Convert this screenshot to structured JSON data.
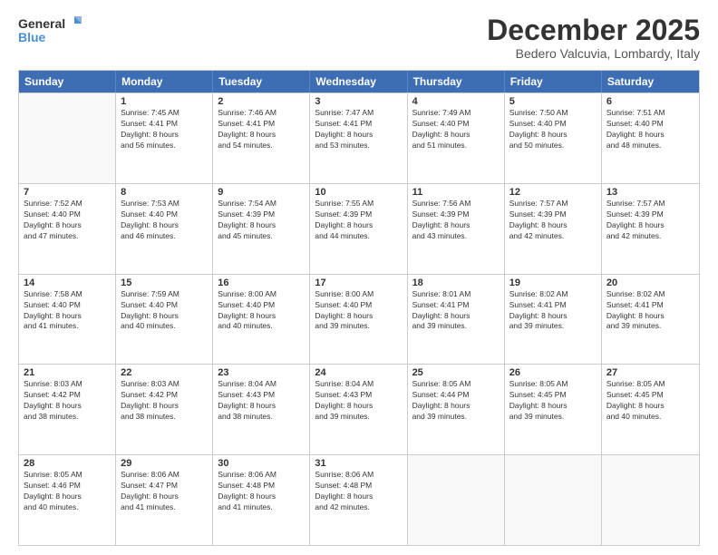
{
  "logo": {
    "line1": "General",
    "line2": "Blue"
  },
  "title": "December 2025",
  "subtitle": "Bedero Valcuvia, Lombardy, Italy",
  "header_days": [
    "Sunday",
    "Monday",
    "Tuesday",
    "Wednesday",
    "Thursday",
    "Friday",
    "Saturday"
  ],
  "weeks": [
    [
      {
        "day": "",
        "sunrise": "",
        "sunset": "",
        "daylight": ""
      },
      {
        "day": "1",
        "sunrise": "Sunrise: 7:45 AM",
        "sunset": "Sunset: 4:41 PM",
        "daylight": "Daylight: 8 hours",
        "daylight2": "and 56 minutes."
      },
      {
        "day": "2",
        "sunrise": "Sunrise: 7:46 AM",
        "sunset": "Sunset: 4:41 PM",
        "daylight": "Daylight: 8 hours",
        "daylight2": "and 54 minutes."
      },
      {
        "day": "3",
        "sunrise": "Sunrise: 7:47 AM",
        "sunset": "Sunset: 4:41 PM",
        "daylight": "Daylight: 8 hours",
        "daylight2": "and 53 minutes."
      },
      {
        "day": "4",
        "sunrise": "Sunrise: 7:49 AM",
        "sunset": "Sunset: 4:40 PM",
        "daylight": "Daylight: 8 hours",
        "daylight2": "and 51 minutes."
      },
      {
        "day": "5",
        "sunrise": "Sunrise: 7:50 AM",
        "sunset": "Sunset: 4:40 PM",
        "daylight": "Daylight: 8 hours",
        "daylight2": "and 50 minutes."
      },
      {
        "day": "6",
        "sunrise": "Sunrise: 7:51 AM",
        "sunset": "Sunset: 4:40 PM",
        "daylight": "Daylight: 8 hours",
        "daylight2": "and 48 minutes."
      }
    ],
    [
      {
        "day": "7",
        "sunrise": "Sunrise: 7:52 AM",
        "sunset": "Sunset: 4:40 PM",
        "daylight": "Daylight: 8 hours",
        "daylight2": "and 47 minutes."
      },
      {
        "day": "8",
        "sunrise": "Sunrise: 7:53 AM",
        "sunset": "Sunset: 4:40 PM",
        "daylight": "Daylight: 8 hours",
        "daylight2": "and 46 minutes."
      },
      {
        "day": "9",
        "sunrise": "Sunrise: 7:54 AM",
        "sunset": "Sunset: 4:39 PM",
        "daylight": "Daylight: 8 hours",
        "daylight2": "and 45 minutes."
      },
      {
        "day": "10",
        "sunrise": "Sunrise: 7:55 AM",
        "sunset": "Sunset: 4:39 PM",
        "daylight": "Daylight: 8 hours",
        "daylight2": "and 44 minutes."
      },
      {
        "day": "11",
        "sunrise": "Sunrise: 7:56 AM",
        "sunset": "Sunset: 4:39 PM",
        "daylight": "Daylight: 8 hours",
        "daylight2": "and 43 minutes."
      },
      {
        "day": "12",
        "sunrise": "Sunrise: 7:57 AM",
        "sunset": "Sunset: 4:39 PM",
        "daylight": "Daylight: 8 hours",
        "daylight2": "and 42 minutes."
      },
      {
        "day": "13",
        "sunrise": "Sunrise: 7:57 AM",
        "sunset": "Sunset: 4:39 PM",
        "daylight": "Daylight: 8 hours",
        "daylight2": "and 42 minutes."
      }
    ],
    [
      {
        "day": "14",
        "sunrise": "Sunrise: 7:58 AM",
        "sunset": "Sunset: 4:40 PM",
        "daylight": "Daylight: 8 hours",
        "daylight2": "and 41 minutes."
      },
      {
        "day": "15",
        "sunrise": "Sunrise: 7:59 AM",
        "sunset": "Sunset: 4:40 PM",
        "daylight": "Daylight: 8 hours",
        "daylight2": "and 40 minutes."
      },
      {
        "day": "16",
        "sunrise": "Sunrise: 8:00 AM",
        "sunset": "Sunset: 4:40 PM",
        "daylight": "Daylight: 8 hours",
        "daylight2": "and 40 minutes."
      },
      {
        "day": "17",
        "sunrise": "Sunrise: 8:00 AM",
        "sunset": "Sunset: 4:40 PM",
        "daylight": "Daylight: 8 hours",
        "daylight2": "and 39 minutes."
      },
      {
        "day": "18",
        "sunrise": "Sunrise: 8:01 AM",
        "sunset": "Sunset: 4:41 PM",
        "daylight": "Daylight: 8 hours",
        "daylight2": "and 39 minutes."
      },
      {
        "day": "19",
        "sunrise": "Sunrise: 8:02 AM",
        "sunset": "Sunset: 4:41 PM",
        "daylight": "Daylight: 8 hours",
        "daylight2": "and 39 minutes."
      },
      {
        "day": "20",
        "sunrise": "Sunrise: 8:02 AM",
        "sunset": "Sunset: 4:41 PM",
        "daylight": "Daylight: 8 hours",
        "daylight2": "and 39 minutes."
      }
    ],
    [
      {
        "day": "21",
        "sunrise": "Sunrise: 8:03 AM",
        "sunset": "Sunset: 4:42 PM",
        "daylight": "Daylight: 8 hours",
        "daylight2": "and 38 minutes."
      },
      {
        "day": "22",
        "sunrise": "Sunrise: 8:03 AM",
        "sunset": "Sunset: 4:42 PM",
        "daylight": "Daylight: 8 hours",
        "daylight2": "and 38 minutes."
      },
      {
        "day": "23",
        "sunrise": "Sunrise: 8:04 AM",
        "sunset": "Sunset: 4:43 PM",
        "daylight": "Daylight: 8 hours",
        "daylight2": "and 38 minutes."
      },
      {
        "day": "24",
        "sunrise": "Sunrise: 8:04 AM",
        "sunset": "Sunset: 4:43 PM",
        "daylight": "Daylight: 8 hours",
        "daylight2": "and 39 minutes."
      },
      {
        "day": "25",
        "sunrise": "Sunrise: 8:05 AM",
        "sunset": "Sunset: 4:44 PM",
        "daylight": "Daylight: 8 hours",
        "daylight2": "and 39 minutes."
      },
      {
        "day": "26",
        "sunrise": "Sunrise: 8:05 AM",
        "sunset": "Sunset: 4:45 PM",
        "daylight": "Daylight: 8 hours",
        "daylight2": "and 39 minutes."
      },
      {
        "day": "27",
        "sunrise": "Sunrise: 8:05 AM",
        "sunset": "Sunset: 4:45 PM",
        "daylight": "Daylight: 8 hours",
        "daylight2": "and 40 minutes."
      }
    ],
    [
      {
        "day": "28",
        "sunrise": "Sunrise: 8:05 AM",
        "sunset": "Sunset: 4:46 PM",
        "daylight": "Daylight: 8 hours",
        "daylight2": "and 40 minutes."
      },
      {
        "day": "29",
        "sunrise": "Sunrise: 8:06 AM",
        "sunset": "Sunset: 4:47 PM",
        "daylight": "Daylight: 8 hours",
        "daylight2": "and 41 minutes."
      },
      {
        "day": "30",
        "sunrise": "Sunrise: 8:06 AM",
        "sunset": "Sunset: 4:48 PM",
        "daylight": "Daylight: 8 hours",
        "daylight2": "and 41 minutes."
      },
      {
        "day": "31",
        "sunrise": "Sunrise: 8:06 AM",
        "sunset": "Sunset: 4:48 PM",
        "daylight": "Daylight: 8 hours",
        "daylight2": "and 42 minutes."
      },
      {
        "day": "",
        "sunrise": "",
        "sunset": "",
        "daylight": ""
      },
      {
        "day": "",
        "sunrise": "",
        "sunset": "",
        "daylight": ""
      },
      {
        "day": "",
        "sunrise": "",
        "sunset": "",
        "daylight": ""
      }
    ]
  ]
}
